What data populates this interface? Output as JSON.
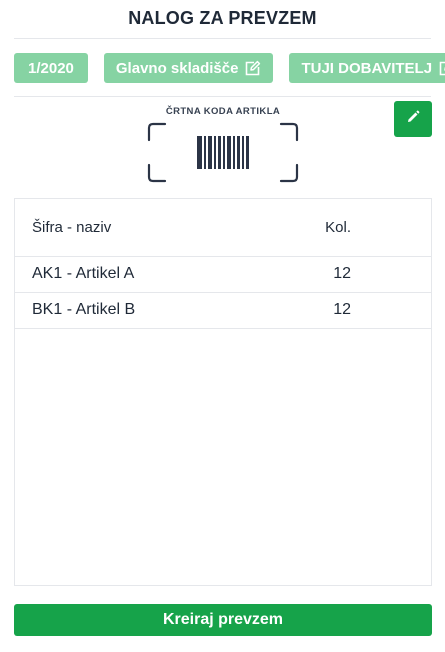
{
  "header": {
    "title": "NALOG ZA PREVZEM"
  },
  "chips": {
    "document_number": "1/2020",
    "warehouse": "Glavno skladišče",
    "supplier": "TUJI DOBAVITELJ"
  },
  "scanner": {
    "label": "ČRTNA KODA ARTIKLA",
    "icon": "barcode-icon"
  },
  "edit_button_icon": "pencil-icon",
  "table": {
    "columns": [
      "Šifra - naziv",
      "Kol."
    ],
    "rows": [
      {
        "name": "AK1 - Artikel A",
        "qty": "12"
      },
      {
        "name": "BK1 - Artikel B",
        "qty": "12"
      }
    ]
  },
  "actions": {
    "create_label": "Kreiraj prevzem"
  },
  "colors": {
    "primary": "#16a34a",
    "chip": "#86d3a3",
    "text": "#1f2937",
    "border": "#e5e7eb"
  }
}
